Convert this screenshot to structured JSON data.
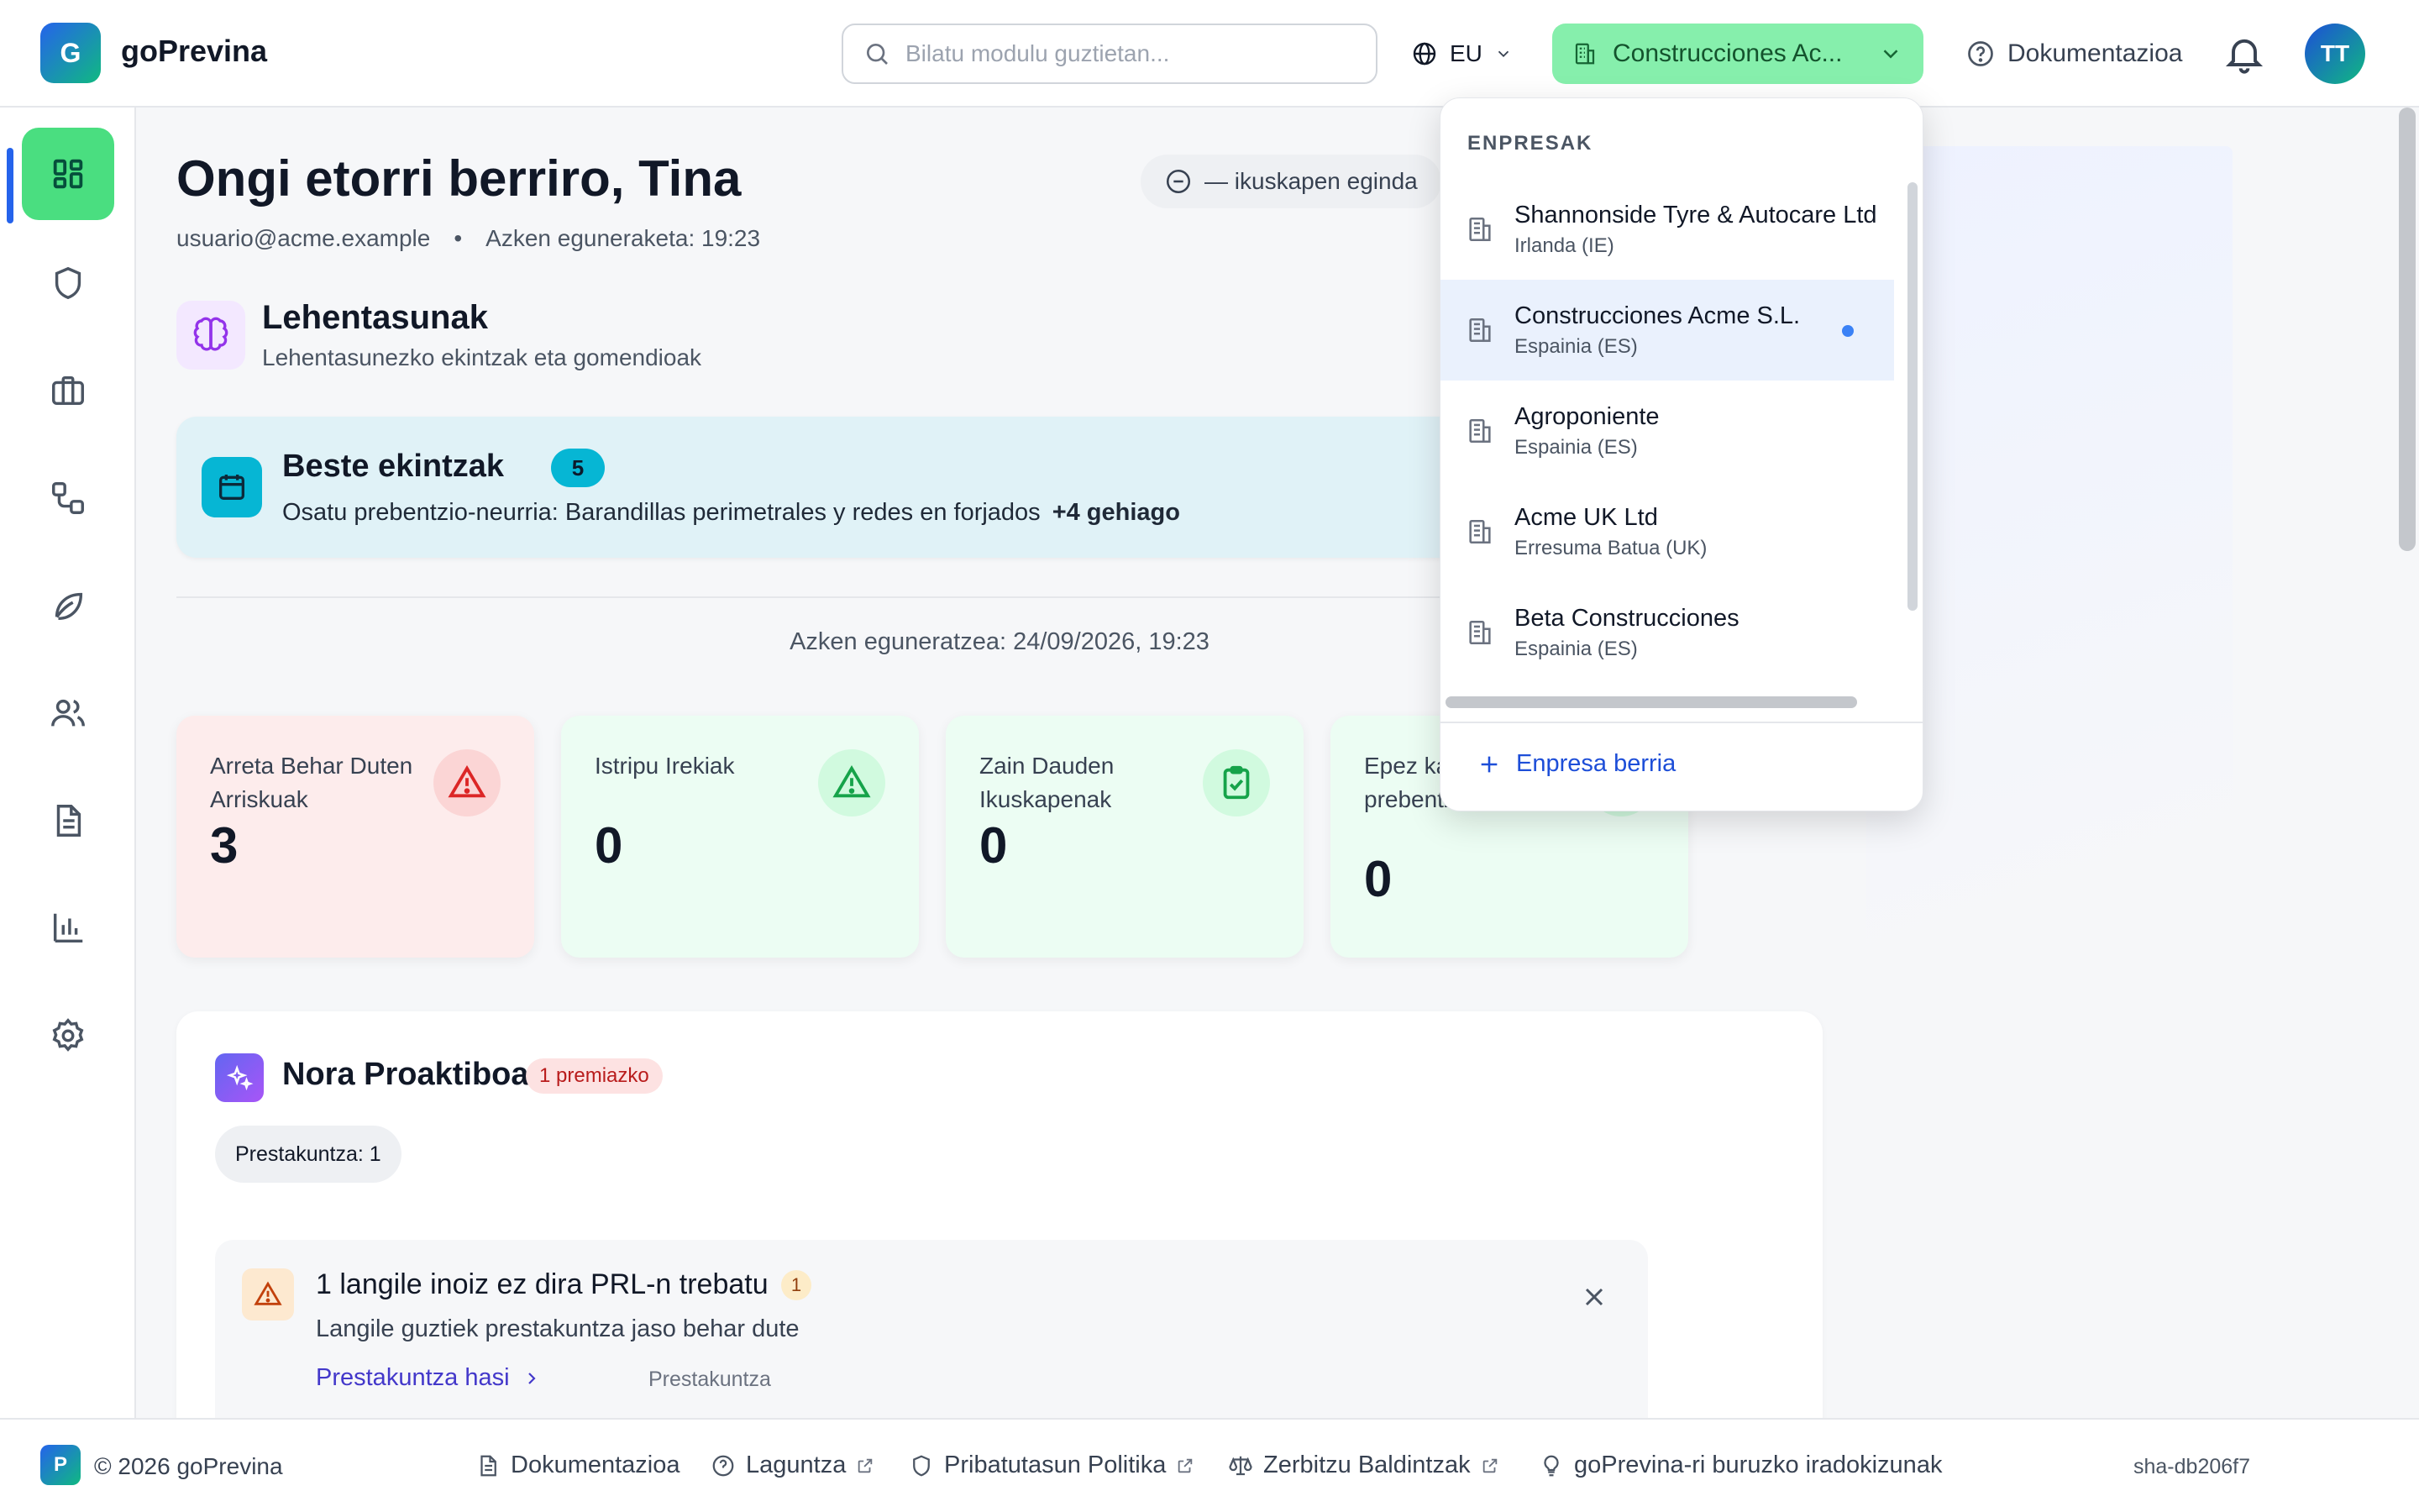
{
  "app": {
    "logo_letter": "G",
    "name": "goPrevina"
  },
  "header": {
    "search_placeholder": "Bilatu modulu guztietan...",
    "language": "EU",
    "company_selected": "Construcciones Ac...",
    "docs_label": "Dokumentazioa",
    "avatar_initials": "TT"
  },
  "sidebar": {
    "items": [
      {
        "icon": "dashboard-icon",
        "active": true
      },
      {
        "icon": "shield-icon"
      },
      {
        "icon": "briefcase-icon"
      },
      {
        "icon": "workflow-icon"
      },
      {
        "icon": "leaf-icon"
      },
      {
        "icon": "users-icon"
      },
      {
        "icon": "document-icon"
      },
      {
        "icon": "bar-chart-icon"
      },
      {
        "icon": "gear-icon"
      }
    ]
  },
  "welcome": {
    "title": "Ongi etorri berriro, Tina",
    "email": "usuario@acme.example",
    "last_update": "Azken eguneraketa: 19:23",
    "inspections_pill": "— ikuskapen eginda"
  },
  "priorities": {
    "title": "Lehentasunak",
    "subtitle": "Lehentasunezko ekintzak eta gomendioak"
  },
  "other_actions": {
    "title": "Beste ekintzak",
    "count": "5",
    "description": "Osatu prebentzio-neurria: Barandillas perimetrales y redes en forjados",
    "more": "+4 gehiago"
  },
  "last_updated": "Azken eguneratzea: 24/09/2026, 19:23",
  "stats": [
    {
      "label": "Arreta Behar Duten Arriskuak",
      "value": "3",
      "tone": "red",
      "icon": "warning-icon",
      "color": "#dc2626"
    },
    {
      "label": "Istripu Irekiak",
      "value": "0",
      "tone": "green",
      "icon": "warning-icon",
      "color": "#16a34a"
    },
    {
      "label": "Zain Dauden Ikuskapenak",
      "value": "0",
      "tone": "green",
      "icon": "clipboard-check-icon",
      "color": "#16a34a"
    },
    {
      "label": "Epez kanpoko prebentzio neurriak",
      "value": "0",
      "tone": "green",
      "icon": "shield-check-icon",
      "color": "#16a34a"
    }
  ],
  "nora": {
    "title": "Nora Proaktiboa",
    "badge": "1 premiazko",
    "chip": "Prestakuntza: 1",
    "alert": {
      "title": "1 langile inoiz ez dira PRL-n trebatu",
      "count": "1",
      "description": "Langile guztiek prestakuntza jaso behar dute",
      "link": "Prestakuntza hasi",
      "tag": "Prestakuntza"
    }
  },
  "dropdown": {
    "heading": "ENPRESAK",
    "companies": [
      {
        "name": "Shannonside Tyre & Autocare Ltd",
        "country": "Irlanda (IE)",
        "selected": false
      },
      {
        "name": "Construcciones Acme S.L.",
        "country": "Espainia (ES)",
        "selected": true
      },
      {
        "name": "Agroponiente",
        "country": "Espainia (ES)",
        "selected": false
      },
      {
        "name": "Acme UK Ltd",
        "country": "Erresuma Batua (UK)",
        "selected": false
      },
      {
        "name": "Beta Construcciones",
        "country": "Espainia (ES)",
        "selected": false
      }
    ],
    "new_company": "Enpresa berria"
  },
  "footer": {
    "logo_letter": "P",
    "copyright": "© 2026 goPrevina",
    "links": [
      {
        "label": "Dokumentazioa",
        "icon": "document-icon",
        "external": false
      },
      {
        "label": "Laguntza",
        "icon": "help-circle-icon",
        "external": true
      },
      {
        "label": "Pribatutasun Politika",
        "icon": "shield-icon",
        "external": true
      },
      {
        "label": "Zerbitzu Baldintzak",
        "icon": "scale-icon",
        "external": true
      },
      {
        "label": "goPrevina-ri buruzko iradokizunak",
        "icon": "lightbulb-icon",
        "external": false
      }
    ],
    "sha": "sha-db206f7"
  },
  "colors": {
    "brand_green": "#4ade80",
    "accent_blue": "#2563eb",
    "cyan": "#06b6d4",
    "danger": "#dc2626"
  }
}
